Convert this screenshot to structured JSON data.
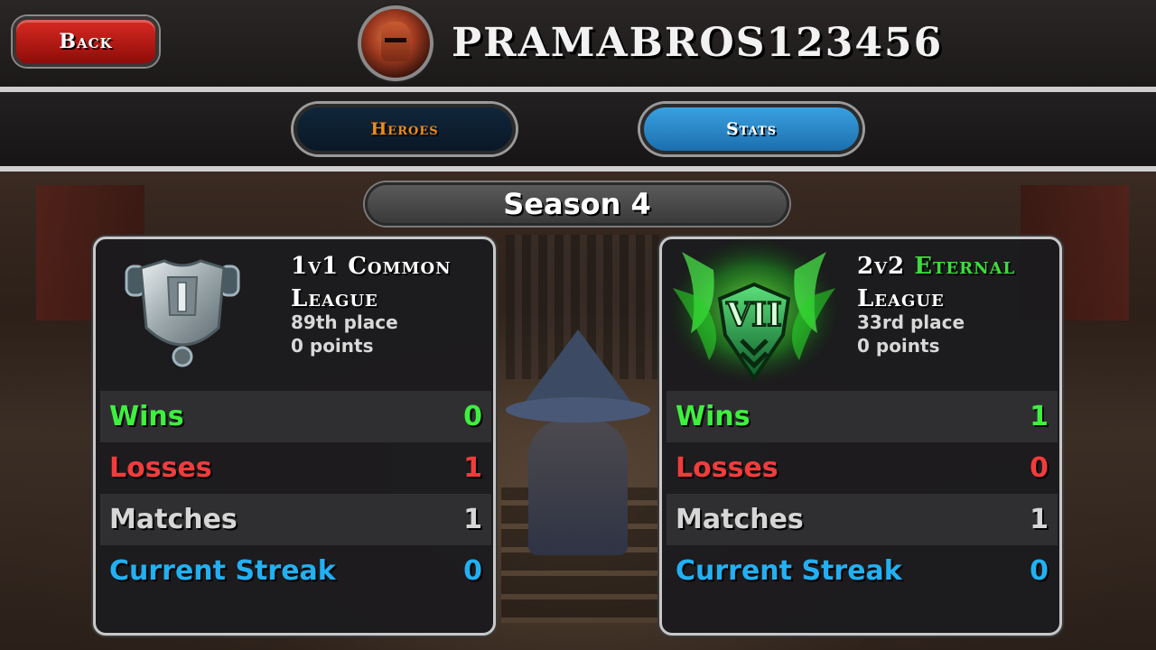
{
  "header": {
    "back_label": "Back",
    "player_name": "PRAMABROS123456"
  },
  "tabs": [
    {
      "label": "Heroes",
      "active": false
    },
    {
      "label": "Stats",
      "active": true
    }
  ],
  "season": {
    "label": "Season 4"
  },
  "leagues": [
    {
      "mode": "1v1",
      "tier": "Common",
      "suffix": "League",
      "tier_color": "#ffffff",
      "badge_icon": "silver-rank-i-shield-icon",
      "place": "89th place",
      "points": "0 points",
      "stats": [
        {
          "label": "Wins",
          "value": "0",
          "color": "#3ef03e"
        },
        {
          "label": "Losses",
          "value": "1",
          "color": "#f23c3c"
        },
        {
          "label": "Matches",
          "value": "1",
          "color": "#d6d6d6"
        },
        {
          "label": "Current Streak",
          "value": "0",
          "color": "#22b0f2"
        }
      ]
    },
    {
      "mode": "2v2",
      "tier": "Eternal",
      "suffix": "League",
      "tier_color": "#3cdc3c",
      "badge_icon": "eternal-rank-vii-green-flame-icon",
      "place": "33rd place",
      "points": "0 points",
      "stats": [
        {
          "label": "Wins",
          "value": "1",
          "color": "#3ef03e"
        },
        {
          "label": "Losses",
          "value": "0",
          "color": "#f23c3c"
        },
        {
          "label": "Matches",
          "value": "1",
          "color": "#d6d6d6"
        },
        {
          "label": "Current Streak",
          "value": "0",
          "color": "#22b0f2"
        }
      ]
    }
  ],
  "colors": {
    "back_button": "#c41c16",
    "tab_active": "#2d8fd0",
    "tab_inactive": "#10263b",
    "heroes_text": "#f08a1a"
  }
}
